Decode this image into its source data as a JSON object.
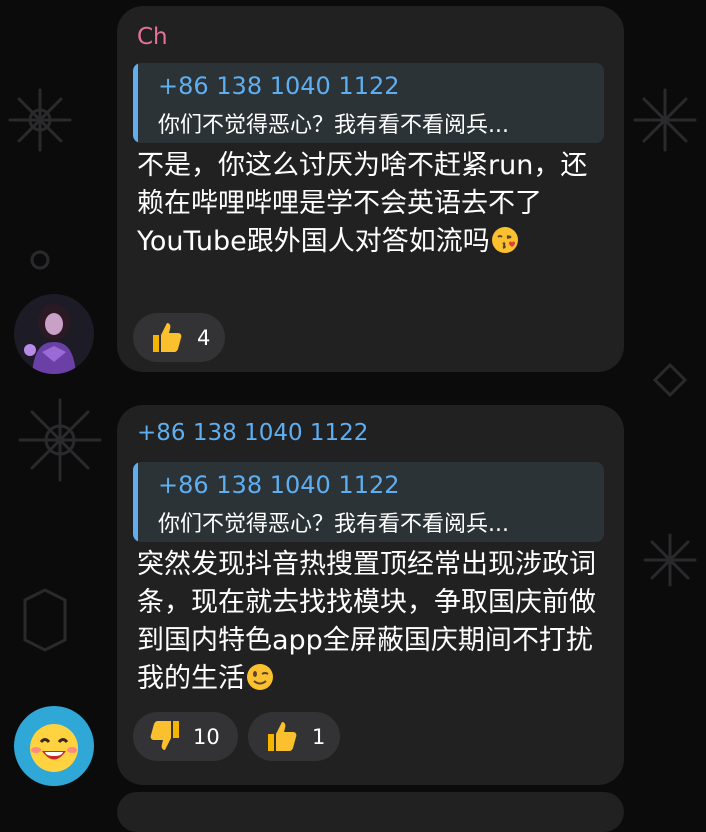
{
  "colors": {
    "background": "#0b0b0c",
    "bubble": "#212121",
    "reply_background": "#2c3337",
    "reply_accent": "#5eaef0",
    "sender_ch": "#e7719a",
    "sender_phone": "#5eaef0",
    "reaction_background": "#333336"
  },
  "messages": [
    {
      "sender": "Ch",
      "avatar": "woman-portrait-avatar",
      "reply": {
        "name": "+86 138 1040 1122",
        "text": "你们不觉得恶心？我有看不看阅兵..."
      },
      "text": "不是，你这么讨厌为啥不赶紧run，还赖在哔哩哔哩是学不会英语去不了YouTube跟外国人对答如流吗",
      "emoji": "kissing-heart-emoji",
      "reactions": [
        {
          "icon": "thumbs-up-icon",
          "count": "4"
        }
      ]
    },
    {
      "sender": "+86 138 1040 1122",
      "avatar": "laughing-emoji-avatar",
      "reply": {
        "name": "+86 138 1040 1122",
        "text": "你们不觉得恶心？我有看不看阅兵..."
      },
      "text": "突然发现抖音热搜置顶经常出现涉政词条，现在就去找找模块，争取国庆前做到国内特色app全屏蔽国庆期间不打扰我的生活",
      "emoji": "winking-face-emoji",
      "reactions": [
        {
          "icon": "thumbs-down-icon",
          "count": "10"
        },
        {
          "icon": "thumbs-up-icon",
          "count": "1"
        }
      ]
    }
  ]
}
